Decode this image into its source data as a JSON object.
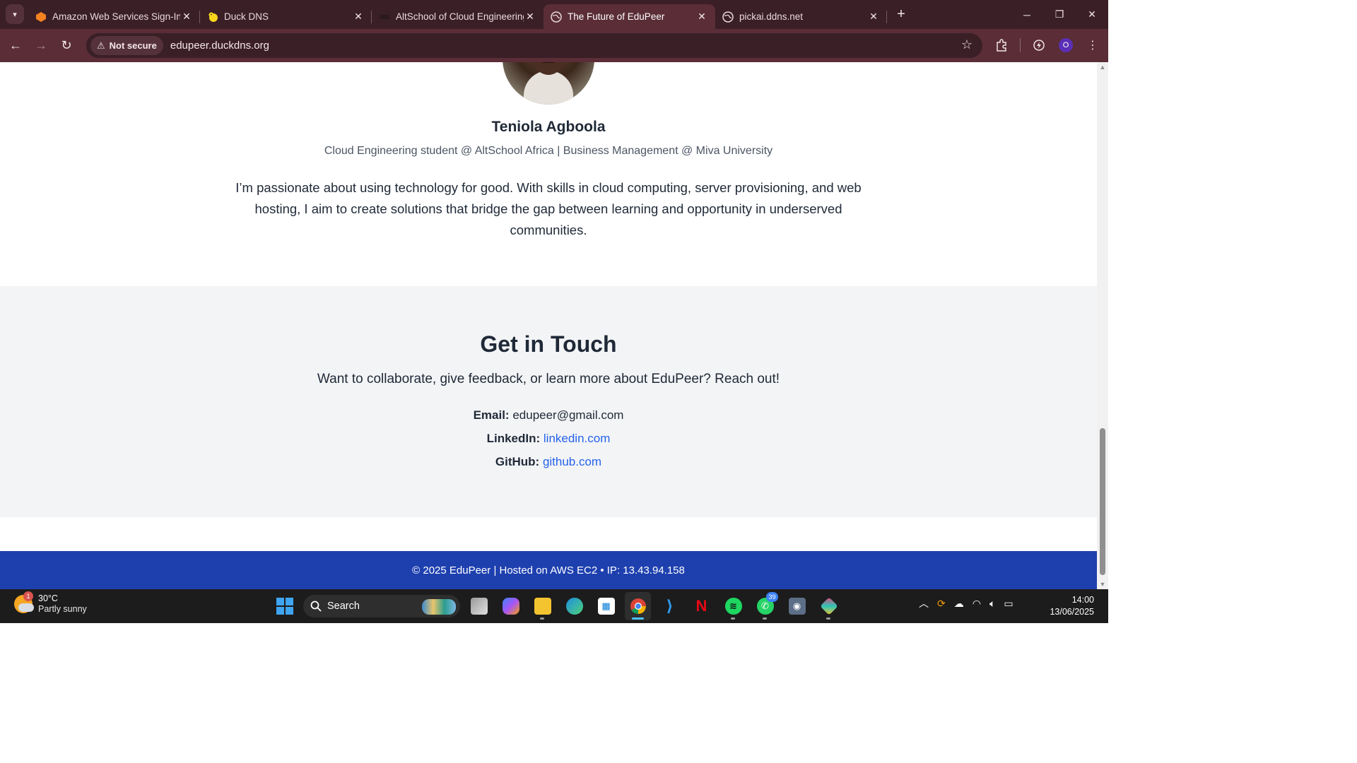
{
  "browser": {
    "tabs": [
      {
        "title": "Amazon Web Services Sign-In",
        "active": false
      },
      {
        "title": "Duck DNS",
        "active": false
      },
      {
        "title": "AltSchool of Cloud Engineering",
        "active": false
      },
      {
        "title": "The Future of EduPeer",
        "active": true
      },
      {
        "title": "pickai.ddns.net",
        "active": false
      }
    ],
    "security_chip": "Not secure",
    "url": "edupeer.duckdns.org",
    "profile_initial": "O"
  },
  "profile": {
    "name": "Teniola Agboola",
    "role": "Cloud Engineering student @ AltSchool Africa | Business Management @ Miva University",
    "bio": "I’m passionate about using technology for good. With skills in cloud computing, server provisioning, and web hosting, I aim to create solutions that bridge the gap between learning and opportunity in underserved communities."
  },
  "contact": {
    "heading": "Get in Touch",
    "lead": "Want to collaborate, give feedback, or learn more about EduPeer? Reach out!",
    "email_label": "Email:",
    "email_value": "edupeer@gmail.com",
    "linkedin_label": "LinkedIn:",
    "linkedin_value": "linkedin.com",
    "github_label": "GitHub:",
    "github_value": "github.com"
  },
  "footer": {
    "text": "© 2025 EduPeer | Hosted on AWS EC2 • IP: 13.43.94.158"
  },
  "taskbar": {
    "weather_badge": "1",
    "temperature": "30°C",
    "condition": "Partly sunny",
    "search_label": "Search",
    "whatsapp_badge": "39",
    "time": "14:00",
    "date": "13/06/2025"
  },
  "colors": {
    "accent_footer": "#1e40af",
    "link": "#2563eb",
    "browser_frame": "#3a1f26",
    "browser_toolbar": "#5a2d37"
  }
}
